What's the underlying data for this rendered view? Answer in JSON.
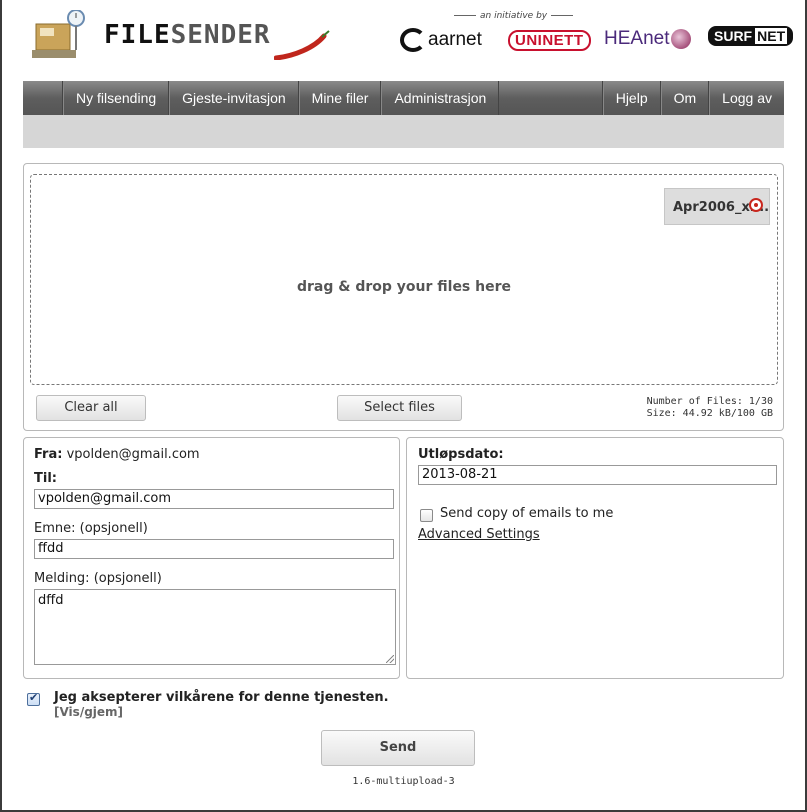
{
  "header": {
    "logo_main": "FILE",
    "logo_accent": "SENDER",
    "initiative": "an initiative by",
    "partners": {
      "aarnet": "aarnet",
      "uninett": "UNINETT",
      "heanet": "HEAnet",
      "surf": "SURF",
      "surf_net": "NET"
    }
  },
  "nav": {
    "left": [
      "Ny filsending",
      "Gjeste-invitasjon",
      "Mine filer",
      "Administrasjon"
    ],
    "right": [
      "Hjelp",
      "Om",
      "Logg av"
    ]
  },
  "upload": {
    "drop_label": "drag & drop your files here",
    "file_name": "Apr2006_xl...",
    "clear_label": "Clear all",
    "select_label": "Select files",
    "number_of_files": "Number of Files: 1/30",
    "size": "Size: 44.92 kB/100 GB"
  },
  "form": {
    "from_label": "Fra:",
    "from_value": "vpolden@gmail.com",
    "to_label": "Til:",
    "to_value": "vpolden@gmail.com",
    "subject_label": "Emne: (opsjonell)",
    "subject_value": "ffdd",
    "message_label": "Melding: (opsjonell)",
    "message_value": "dffd",
    "expiry_label": "Utløpsdato:",
    "expiry_value": "2013-08-21",
    "copy_label": "Send copy of emails to me",
    "copy_checked": false,
    "advanced_label": "Advanced Settings"
  },
  "terms": {
    "label": "Jeg aksepterer vilkårene for denne tjenesten.",
    "toggle": "[Vis/gjem]",
    "checked": true
  },
  "send_label": "Send",
  "version": "1.6-multiupload-3"
}
